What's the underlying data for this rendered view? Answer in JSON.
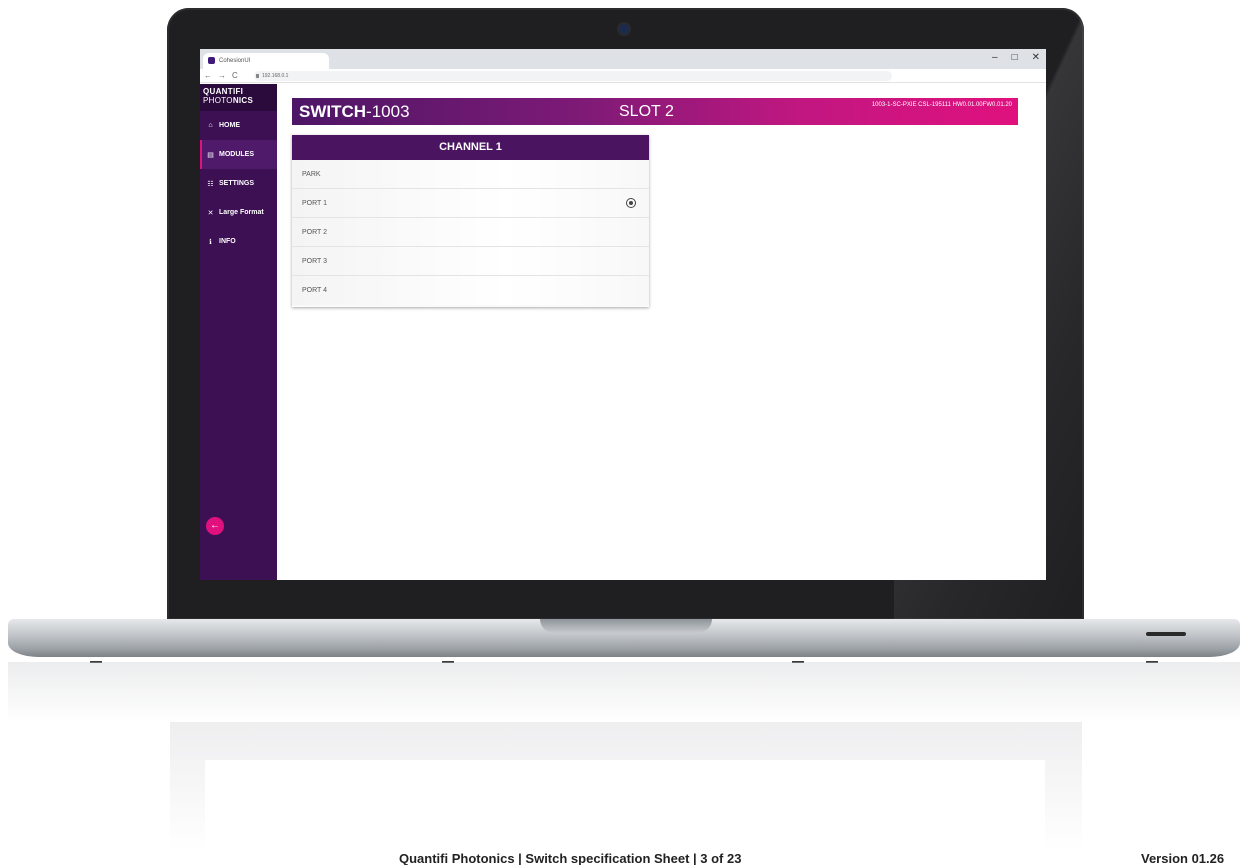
{
  "browser": {
    "tab_title": "CohesionUI",
    "url": "192.168.0.1",
    "minimize": "–",
    "maximize": "□",
    "close": "✕",
    "back": "←",
    "forward": "→",
    "reload": "C"
  },
  "sidebar": {
    "logo_line1": "QUANTIFI",
    "logo_line2_light": "PHOTO",
    "logo_line2_bold": "NICS",
    "items": [
      {
        "label": "HOME",
        "icon": "home-icon",
        "glyph": "⌂"
      },
      {
        "label": "MODULES",
        "icon": "modules-icon",
        "glyph": "▤"
      },
      {
        "label": "SETTINGS",
        "icon": "settings-icon",
        "glyph": "☷"
      },
      {
        "label": "Large Format",
        "icon": "large-format-icon",
        "glyph": "✕"
      },
      {
        "label": "INFO",
        "icon": "info-icon",
        "glyph": "ℹ"
      }
    ],
    "back_button_glyph": "←"
  },
  "header": {
    "name_bold": "SWITCH",
    "name_rest": "-1003",
    "slot": "SLOT 2",
    "info": "1003-1-SC-PXIE CSL-195111 HW0.01.00FW0.01.20"
  },
  "channel": {
    "title": "CHANNEL 1",
    "rows": [
      {
        "label": "PARK",
        "selected": false
      },
      {
        "label": "PORT 1",
        "selected": true
      },
      {
        "label": "PORT 2",
        "selected": false
      },
      {
        "label": "PORT 3",
        "selected": false
      },
      {
        "label": "PORT 4",
        "selected": false
      }
    ]
  },
  "footer": {
    "left": "Quantifi Photonics | Switch specification Sheet | 3 of 23",
    "right": "Version 01.26"
  },
  "colors": {
    "sidebar": "#3c1052",
    "accent": "#e0117f",
    "header_start": "#4d1666",
    "card_title": "#4a1460"
  }
}
